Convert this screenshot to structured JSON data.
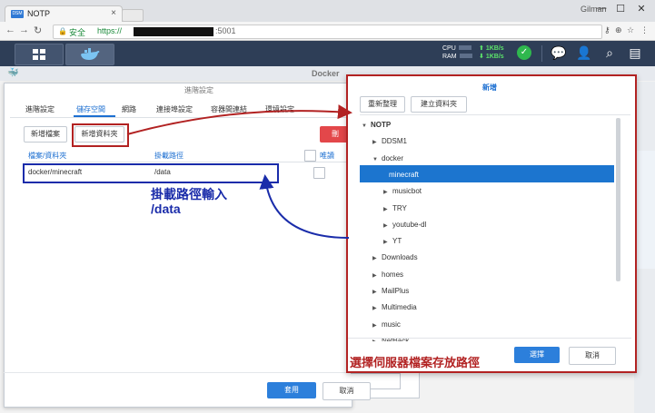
{
  "browser": {
    "tab_title": "NOTP",
    "favicon_text": "DSM",
    "tab_close": "×",
    "user": "Gilman",
    "win_min": "—",
    "win_max": "☐",
    "win_close": "✕",
    "secure_label": "安全",
    "url_prefix": "https://",
    "url_port": ":5001"
  },
  "dsm": {
    "cpu_label": "CPU",
    "ram_label": "RAM",
    "upload": "1KB/s",
    "download": "1KB/s"
  },
  "docker": {
    "title": "Docker"
  },
  "advanced": {
    "title": "進階設定",
    "tabs": [
      "進階設定",
      "儲存空間",
      "網路",
      "連接埠設定",
      "容器間連結",
      "環境設定"
    ],
    "add_file_button": "新增檔案",
    "add_folder_button": "新增資料夾",
    "delete_button": "刪",
    "columns": [
      "檔案/資料夾",
      "掛載路徑",
      "唯讀"
    ],
    "rows": [
      {
        "folder": "docker/minecraft",
        "mount": "/data"
      }
    ],
    "apply_button": "套用",
    "cancel_button": "取消"
  },
  "picker": {
    "title": "新增",
    "refresh_button": "重新整理",
    "create_folder_button": "建立資料夾",
    "tree": [
      {
        "label": "NOTP",
        "level": 0,
        "expanded": true,
        "selected": false
      },
      {
        "label": "DDSM1",
        "level": 1,
        "expanded": false,
        "selected": false
      },
      {
        "label": "docker",
        "level": 1,
        "expanded": true,
        "selected": false
      },
      {
        "label": "minecraft",
        "level": 2,
        "expanded": false,
        "selected": true
      },
      {
        "label": "musicbot",
        "level": 2,
        "expanded": false,
        "selected": false
      },
      {
        "label": "TRY",
        "level": 2,
        "expanded": false,
        "selected": false
      },
      {
        "label": "youtube-dl",
        "level": 2,
        "expanded": false,
        "selected": false
      },
      {
        "label": "YT",
        "level": 2,
        "expanded": false,
        "selected": false
      },
      {
        "label": "Downloads",
        "level": 1,
        "expanded": false,
        "selected": false
      },
      {
        "label": "homes",
        "level": 1,
        "expanded": false,
        "selected": false
      },
      {
        "label": "MailPlus",
        "level": 1,
        "expanded": false,
        "selected": false
      },
      {
        "label": "Multimedia",
        "level": 1,
        "expanded": false,
        "selected": false
      },
      {
        "label": "music",
        "level": 1,
        "expanded": false,
        "selected": false
      },
      {
        "label": "NetBack...",
        "level": 1,
        "expanded": false,
        "selected": false
      }
    ],
    "ok_button": "選擇",
    "cancel_button": "取消"
  },
  "annotations": {
    "mount_note_line1": "掛載路徑輸入",
    "mount_note_line2": "/data",
    "picker_note": "選擇伺服器檔案存放路徑",
    "blue": "#1a2caa",
    "red": "#b22222"
  },
  "colors": {
    "accent": "#1c6fd1",
    "header": "#2e3e57",
    "status_ok": "#2fb84e"
  }
}
